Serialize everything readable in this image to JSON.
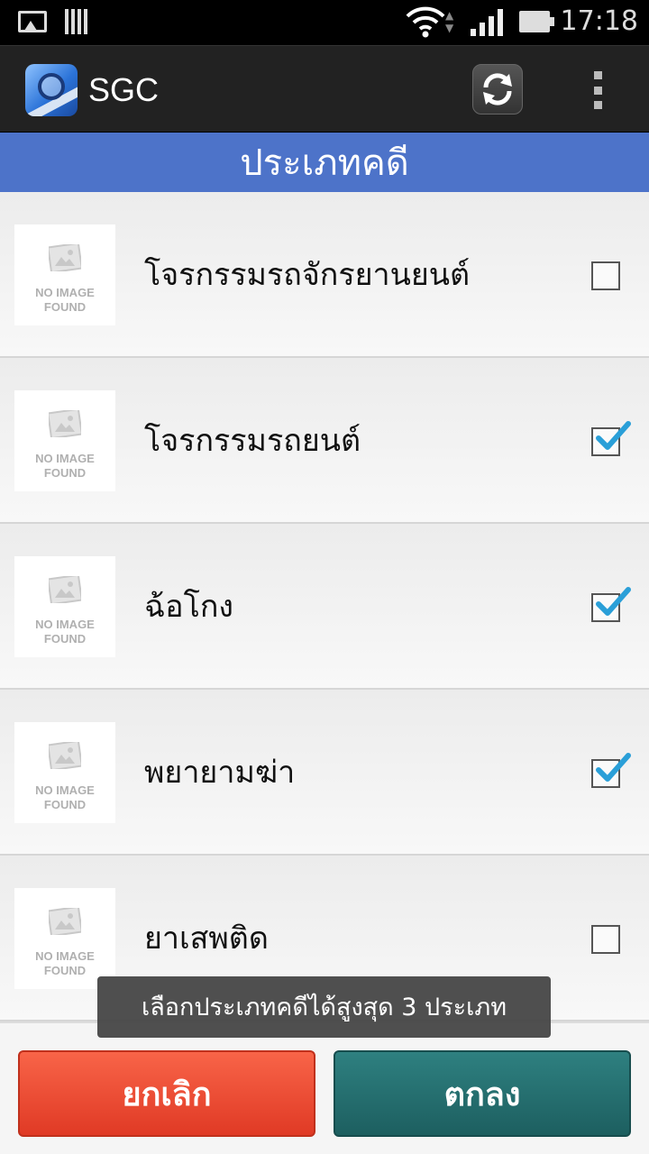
{
  "status_bar": {
    "time": "17:18",
    "icons": [
      "gallery-icon",
      "sim-bars-icon",
      "wifi-icon",
      "signal-icon",
      "battery-icon"
    ]
  },
  "action_bar": {
    "title": "SGC",
    "icons": [
      "app-logo-icon",
      "refresh-icon",
      "overflow-menu-icon"
    ]
  },
  "section_header": "ประเภทคดี",
  "list": {
    "placeholder_line1": "NO IMAGE",
    "placeholder_line2": "FOUND",
    "items": [
      {
        "label": "โจรกรรมรถจักรยานยนต์",
        "checked": false
      },
      {
        "label": "โจรกรรมรถยนต์",
        "checked": true
      },
      {
        "label": "ฉ้อโกง",
        "checked": true
      },
      {
        "label": "พยายามฆ่า",
        "checked": true
      },
      {
        "label": "ยาเสพติด",
        "checked": false
      }
    ]
  },
  "toast": "เลือกประเภทคดีได้สูงสุด 3 ประเภท",
  "buttons": {
    "cancel": "ยกเลิก",
    "ok": "ตกลง"
  },
  "colors": {
    "header": "#4d73c9",
    "cancel": "#e84a30",
    "ok": "#266b6c",
    "check": "#2a9fd8"
  }
}
